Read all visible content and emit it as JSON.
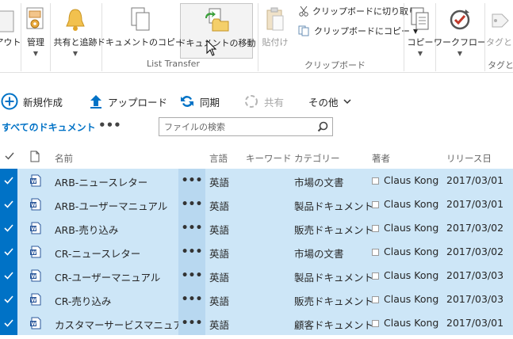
{
  "ribbon": {
    "partial_left_label": "アウト",
    "manage": "管理",
    "share": "共有と追跡",
    "copy_doc": "ドキュメントのコピー",
    "move_doc": "ドキュメントの移動",
    "group_list_transfer": "List Transfer",
    "paste": "貼付け",
    "cut": "クリップボードに切り取り",
    "copy_clip": "クリップボードにコピー",
    "group_clipboard": "クリップボード",
    "copy": "コピー",
    "workflow": "ワークフロー",
    "tags_partial": "タグとメ",
    "tags_partial2": "タグとメ"
  },
  "commands": {
    "new": "新規作成",
    "upload": "アップロード",
    "sync": "同期",
    "share": "共有",
    "more": "その他"
  },
  "view": {
    "name": "すべてのドキュメント",
    "more": "•••",
    "search_placeholder": "ファイルの検索"
  },
  "columns": {
    "name": "名前",
    "language": "言語",
    "keyword": "キーワード",
    "category": "カテゴリー",
    "author": "著者",
    "release": "リリース日"
  },
  "rows": [
    {
      "name": "ARB-ニュースレター",
      "lang": "英語",
      "category": "市場の文書",
      "author": "Claus Kong",
      "date": "2017/03/01"
    },
    {
      "name": "ARB-ユーザーマニュアル",
      "lang": "英語",
      "category": "製品ドキュメント",
      "author": "Claus Kong",
      "date": "2017/03/01"
    },
    {
      "name": "ARB-売り込み",
      "lang": "英語",
      "category": "販売ドキュメント",
      "author": "Claus Kong",
      "date": "2017/03/02"
    },
    {
      "name": "CR-ニュースレター",
      "lang": "英語",
      "category": "市場の文書",
      "author": "Claus Kong",
      "date": "2017/03/02"
    },
    {
      "name": "CR-ユーザーマニュアル",
      "lang": "英語",
      "category": "製品ドキュメント",
      "author": "Claus Kong",
      "date": "2017/03/03"
    },
    {
      "name": "CR-売り込み",
      "lang": "英語",
      "category": "販売ドキュメント",
      "author": "Claus Kong",
      "date": "2017/03/03"
    },
    {
      "name": "カスタマーサービスマニュアル",
      "lang": "英語",
      "category": "顧客ドキュメント",
      "author": "Claus Kong",
      "date": "2017/03/01"
    }
  ],
  "row_more": "•••",
  "colors": {
    "accent": "#0072c6",
    "row_selected": "#cde6f7",
    "row_dots": "#b8d8f0"
  }
}
